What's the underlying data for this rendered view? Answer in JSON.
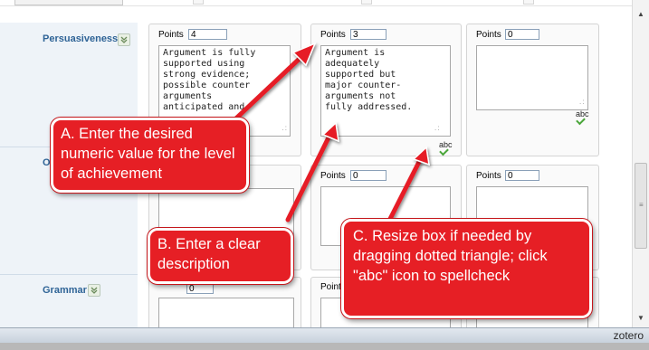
{
  "points_label": "Points",
  "abc_label": "abc",
  "grip_glyph": ".:",
  "criteria": [
    {
      "name": "Persuasiveness"
    },
    {
      "name": "Or"
    },
    {
      "name": "Grammar"
    }
  ],
  "cells": {
    "persuasiveness": [
      {
        "points": "4",
        "description": "Argument is fully\nsupported using\nstrong evidence;\npossible counter\narguments\nanticipated and"
      },
      {
        "points": "3",
        "description": "Argument is\nadequately\nsupported but\nmajor counter-\narguments not\nfully addressed."
      },
      {
        "points": "0",
        "description": ""
      }
    ],
    "organization": [
      {
        "points": "0",
        "description": ""
      },
      {
        "points": "0",
        "description": ""
      }
    ],
    "grammar": [
      {
        "points": "0",
        "description": ""
      },
      {
        "points_label_partial": "Point"
      },
      {
        "points": "",
        "description": ""
      }
    ]
  },
  "callouts": {
    "a": "A. Enter the desired numeric value for the level of achievement",
    "b": "B. Enter a clear description",
    "c": "C. Resize box if needed by dragging dotted triangle; click \"abc\" icon to spellcheck"
  },
  "statusbar": {
    "zotero": "zotero"
  },
  "colors": {
    "callout": "#e61f25",
    "criterion_text": "#2e6396",
    "spellcheck_ok": "#4aa63a"
  },
  "icons": [
    "chevron-down-icon",
    "spellcheck-icon",
    "resize-grip-icon",
    "scroll-up-icon",
    "scroll-down-icon"
  ]
}
